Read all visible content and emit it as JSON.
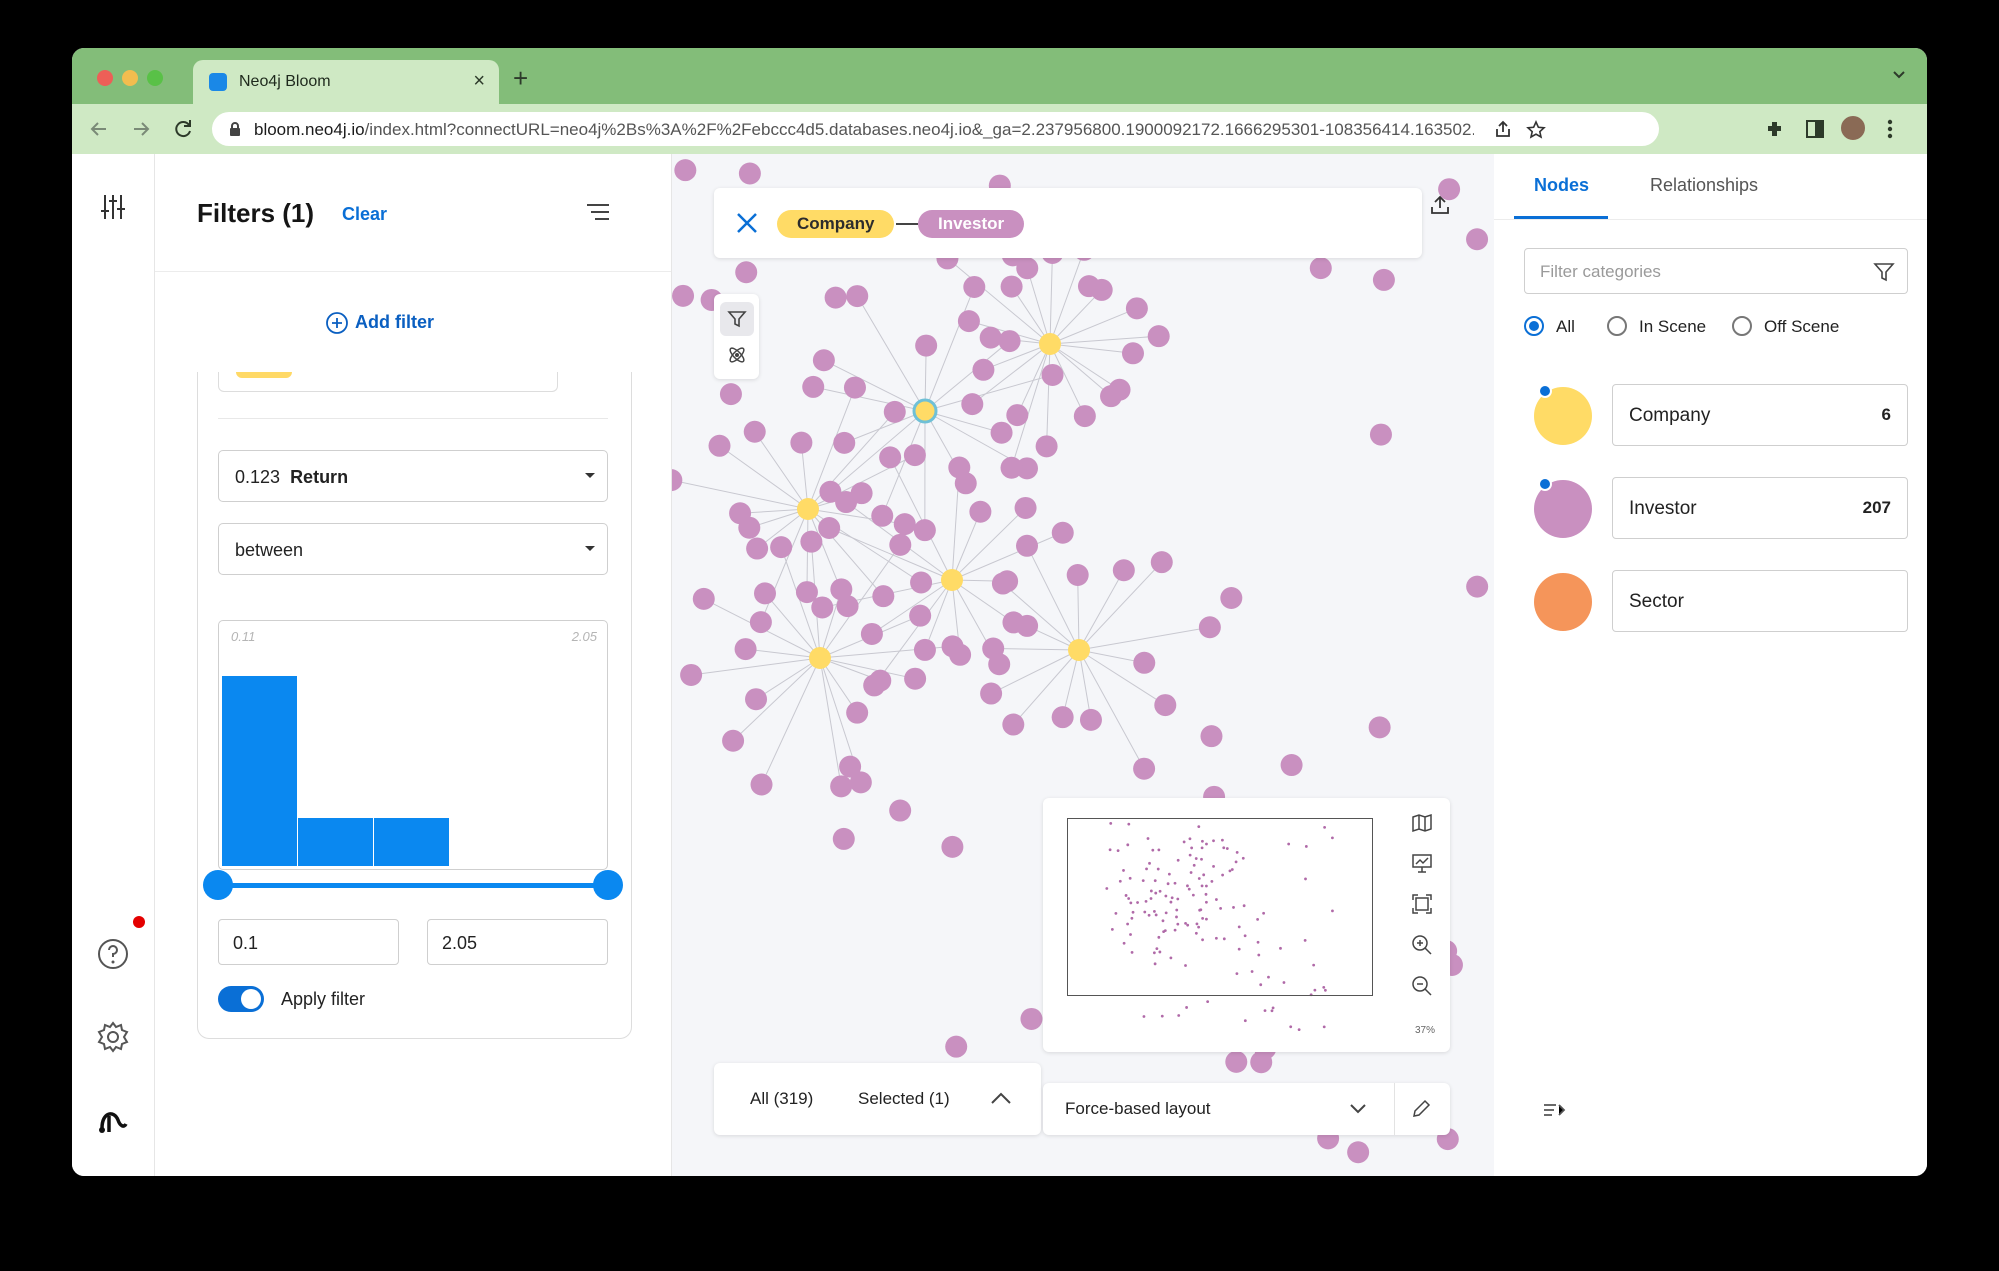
{
  "browser": {
    "tab_title": "Neo4j Bloom",
    "url_host": "bloom.neo4j.io",
    "url_rest": "/index.html?connectURL=neo4j%2Bs%3A%2F%2Febccc4d5.databases.neo4j.io&_ga=2.237956800.1900092172.1666295301-108356414.163502...",
    "new_tab_label": "+",
    "close_label": "×"
  },
  "filters": {
    "title": "Filters (1)",
    "clear_label": "Clear",
    "add_filter_label": "Add filter",
    "property_value": "0.123",
    "property_name": "Return",
    "operator": "between",
    "histogram_min_label": "0.11",
    "histogram_max_label": "2.05",
    "histogram_bins": [
      1.0,
      0.25,
      0.25,
      0,
      0,
      0
    ],
    "range_min": "0.1",
    "range_max": "2.05",
    "apply_label": "Apply filter",
    "apply_enabled": true
  },
  "search": {
    "node_a": "Company",
    "node_b": "Investor"
  },
  "graph": {
    "company_color": "#ffdb66",
    "investor_color": "#c990c0",
    "sector_color": "#f5955a"
  },
  "bottom": {
    "all_count": "All (319)",
    "selected_count": "Selected (1)",
    "layout": "Force-based layout"
  },
  "minimap": {
    "zoom": "37%"
  },
  "legend": {
    "tab_nodes": "Nodes",
    "tab_relationships": "Relationships",
    "filter_placeholder": "Filter categories",
    "radio_all": "All",
    "radio_in_scene": "In Scene",
    "radio_off_scene": "Off Scene",
    "categories": [
      {
        "name": "Company",
        "count": "6"
      },
      {
        "name": "Investor",
        "count": "207"
      },
      {
        "name": "Sector",
        "count": ""
      }
    ]
  }
}
